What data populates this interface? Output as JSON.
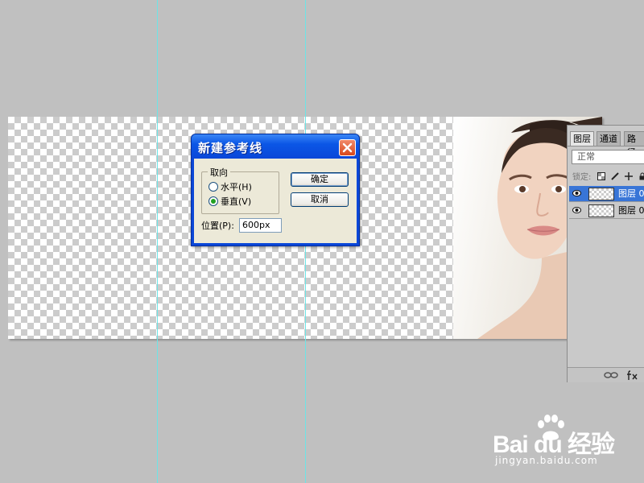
{
  "dialog": {
    "title": "新建参考线",
    "orientation_group": {
      "legend": "取向",
      "options": [
        {
          "label": "水平(H)",
          "selected": false
        },
        {
          "label": "垂直(V)",
          "selected": true
        }
      ]
    },
    "position_label": "位置(P):",
    "position_value": "600px",
    "ok_label": "确定",
    "cancel_label": "取消",
    "close_icon": "close-x-icon"
  },
  "layers_panel": {
    "tabs": [
      "图层",
      "通道",
      "路径"
    ],
    "active_tab": "图层",
    "blend_mode": "正常",
    "lock_label": "锁定:",
    "layers": [
      {
        "name": "图层 0",
        "selected": true
      },
      {
        "name": "图层 0",
        "selected": false
      }
    ],
    "footer_icons": [
      "link-icon",
      "fx-icon"
    ]
  },
  "colors": {
    "guide": "#6ee4e6",
    "dialog_title_bar": "#0a47d8",
    "selected_layer": "#3875d7",
    "workspace": "#c0c0c0"
  },
  "watermark": {
    "brand": "Bai du 经验",
    "url": "jingyan.baidu.com"
  }
}
